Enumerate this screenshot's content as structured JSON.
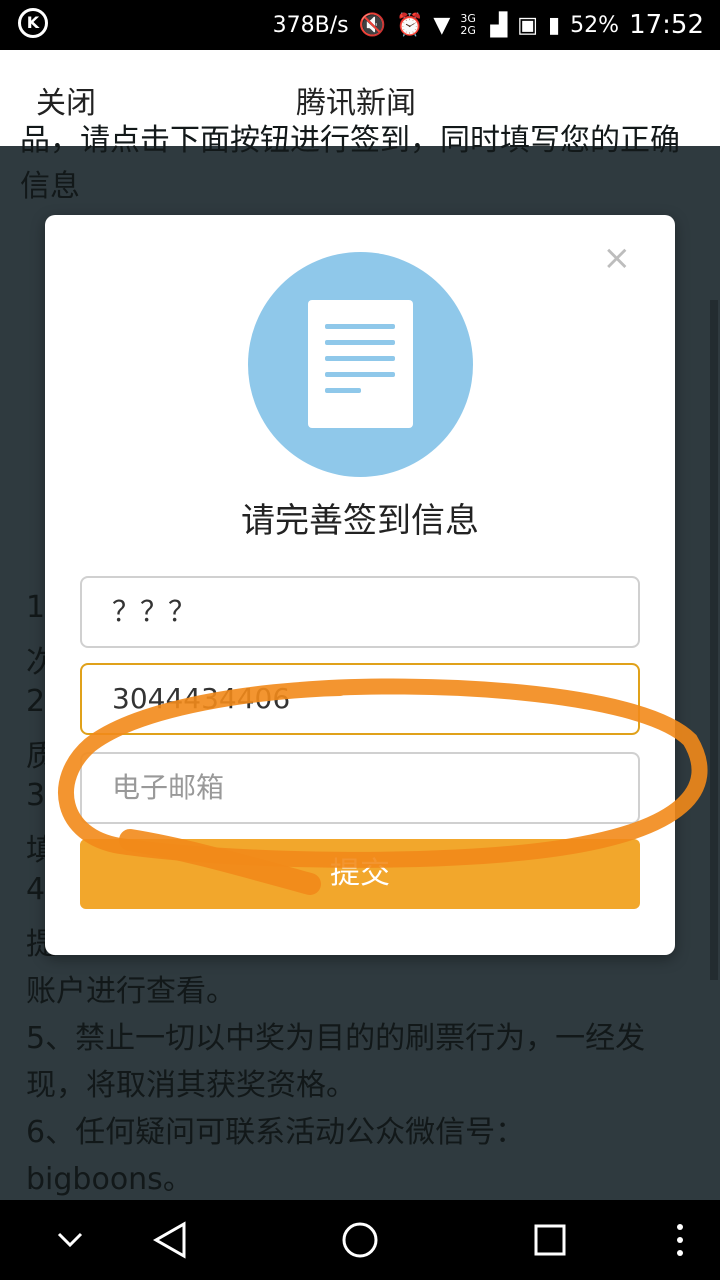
{
  "status_bar": {
    "network_speed": "378B/s",
    "network_type": "3G 2G",
    "battery": "52%",
    "time": "17:52",
    "icons": [
      "k-logo-icon",
      "mute-icon",
      "alarm-icon",
      "wifi-icon",
      "signal-icon",
      "sim-icon",
      "battery-icon"
    ]
  },
  "app_bar": {
    "close_label": "关闭",
    "title": "腾讯新闻"
  },
  "background": {
    "top_lines": [
      "品，请点击下面按钮进行签到，同时填写您的正确",
      "信息"
    ],
    "list_numbers": [
      "1",
      "次",
      "2",
      "质",
      "3",
      "填",
      "4",
      "提"
    ],
    "bottom_lines": [
      "账户进行查看。",
      "5、禁止一切以中奖为目的的刷票行为，一经发",
      "现，将取消其获奖资格。",
      "6、任何疑问可联系活动公众微信号：",
      "bigboons。"
    ]
  },
  "modal": {
    "close_glyph": "×",
    "icon": "document-icon",
    "title": "请完善签到信息",
    "name_value": "？？？",
    "phone_value": "3044434406",
    "email_placeholder": "电子邮箱",
    "submit_label": "提交"
  },
  "colors": {
    "accent": "#f2a72c",
    "circle": "#8fc8ea",
    "annotation": "#f28a1a"
  },
  "nav_bar": {
    "icons": [
      "chevron-down-icon",
      "back-icon",
      "home-icon",
      "recents-icon",
      "more-icon"
    ]
  }
}
